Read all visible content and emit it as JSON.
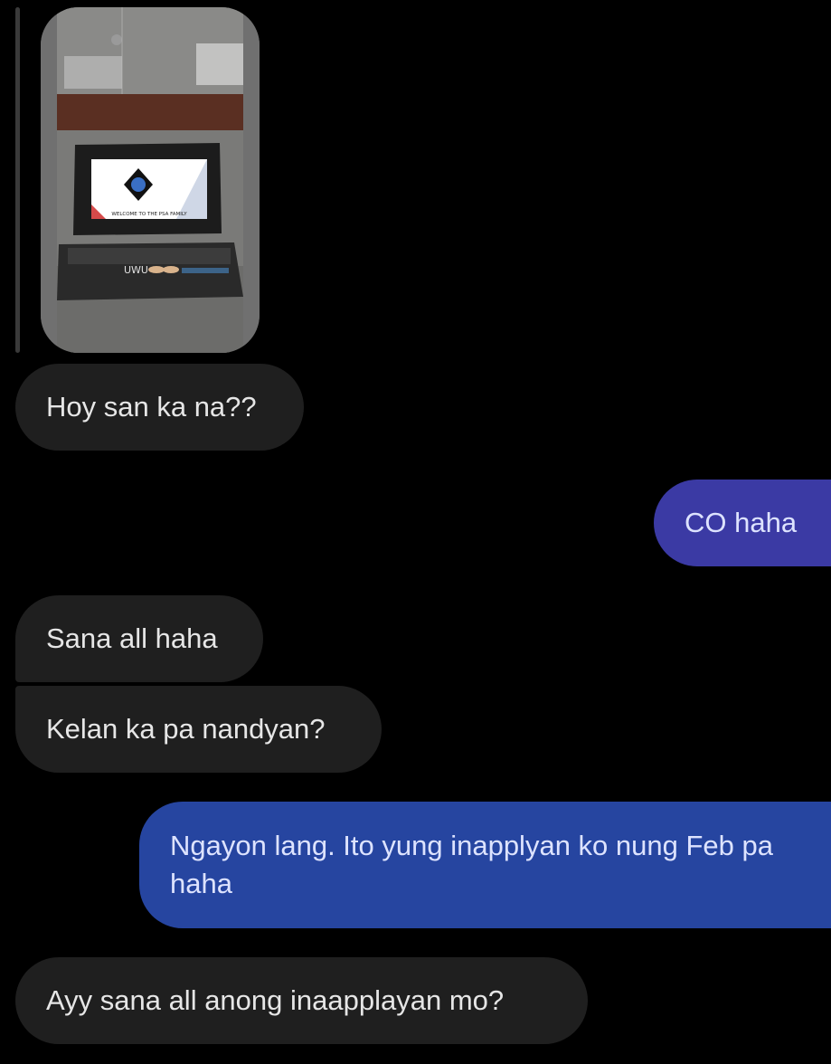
{
  "conversation": {
    "photo_message": {
      "icon": "image-photo",
      "screen_text": "WELCOME TO THE PSA FAMILY",
      "caption": "UWU"
    },
    "messages": [
      {
        "from": "other",
        "text": "Hoy san ka na??"
      },
      {
        "from": "me",
        "text": "CO haha"
      },
      {
        "from": "other",
        "text": "Sana all haha"
      },
      {
        "from": "other",
        "text": "Kelan ka pa nandyan?"
      },
      {
        "from": "me",
        "text": "Ngayon lang. Ito yung inapplyan ko nung Feb pa haha"
      },
      {
        "from": "other",
        "text": "Ayy sana all anong inaapplayan mo?"
      }
    ]
  },
  "colors": {
    "background": "#000000",
    "incoming_bubble": "#1f1f1f",
    "outgoing_bubble_1": "#3b3aa4",
    "outgoing_bubble_2": "#2645a0"
  }
}
